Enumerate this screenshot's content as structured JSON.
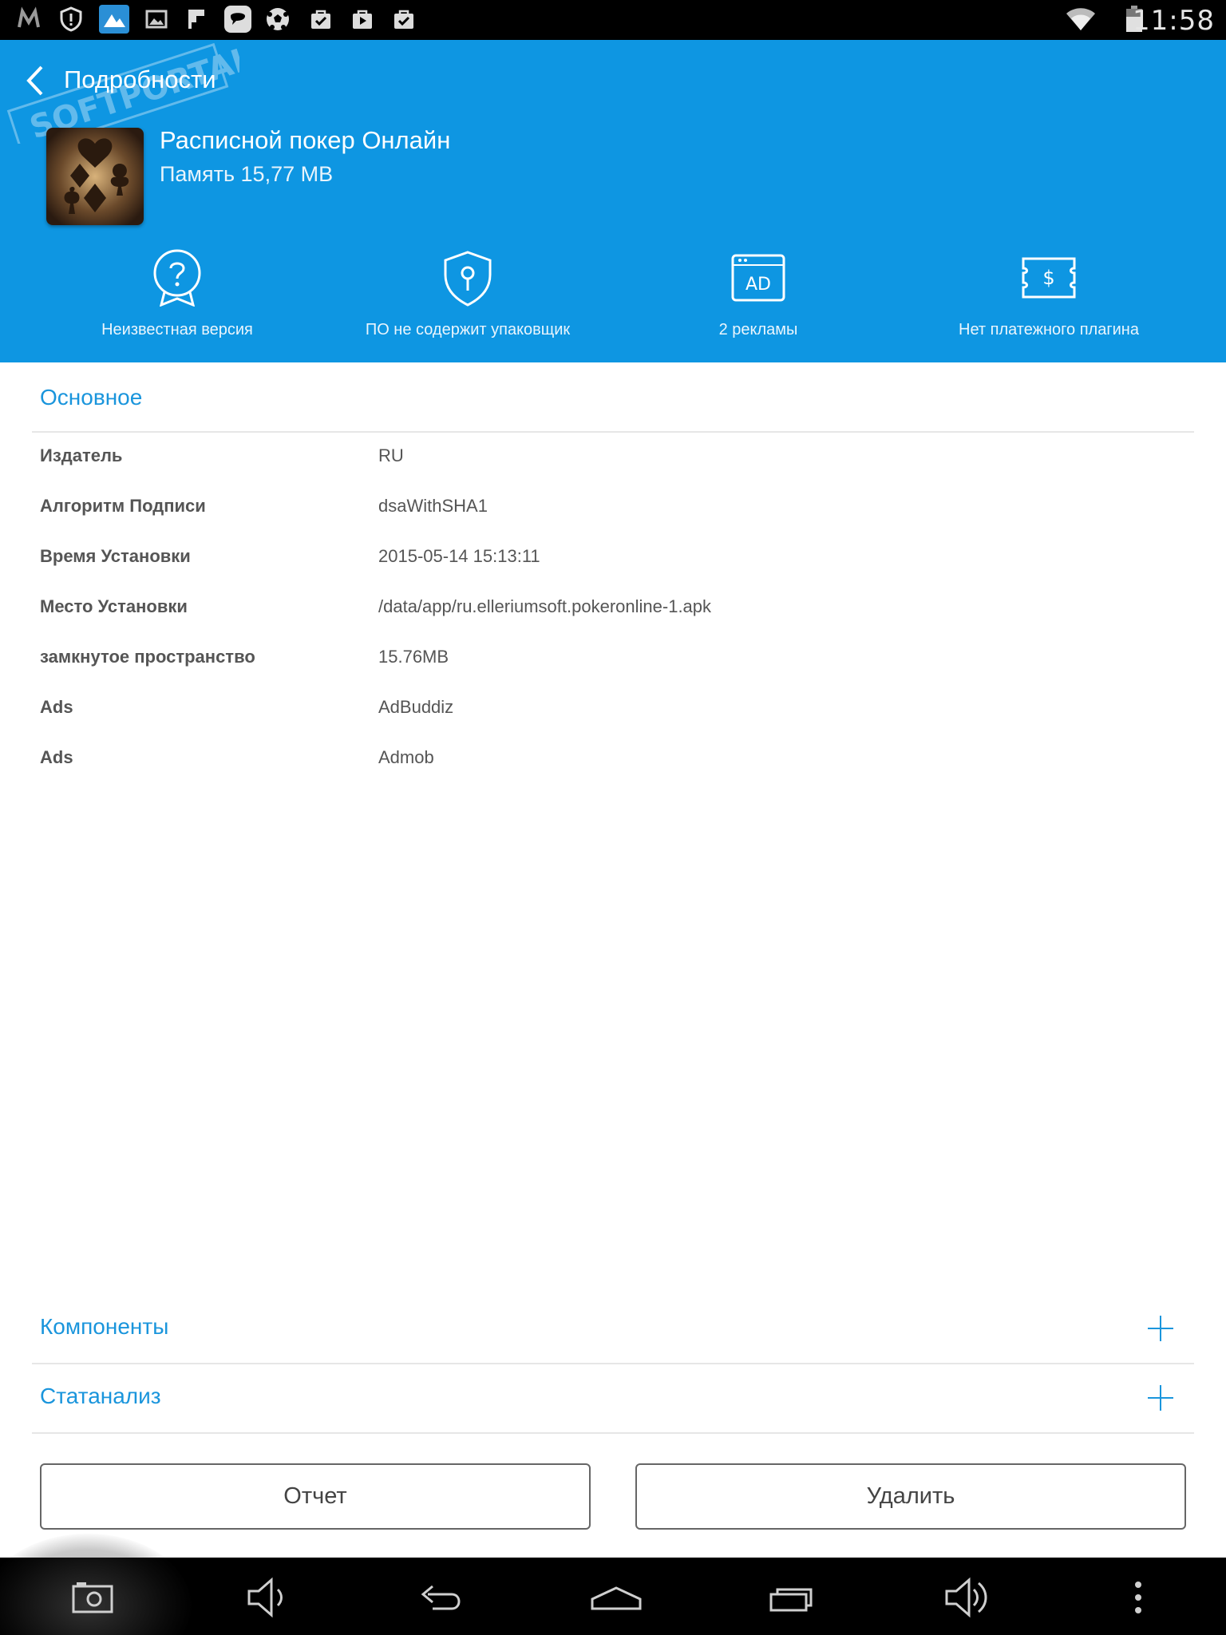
{
  "status_bar": {
    "time": "11:58",
    "icons": [
      "m-app-icon",
      "shield-alert-icon",
      "gallery-app-icon",
      "image-icon",
      "flipboard-icon",
      "chat-app-icon",
      "soccer-ball-icon",
      "bag-check-icon",
      "bag-play-icon",
      "bag-check-icon",
      "wifi-icon",
      "battery-icon"
    ]
  },
  "header": {
    "title": "Подробности",
    "app_name": "Расписной покер Онлайн",
    "memory": "Память 15,77 MB",
    "features": [
      {
        "icon": "question-badge-icon",
        "label": "Неизвестная версия"
      },
      {
        "icon": "shield-key-icon",
        "label": "ПО не содержит упаковщик"
      },
      {
        "icon": "ad-window-icon",
        "label": "2 рекламы"
      },
      {
        "icon": "dollar-card-icon",
        "label": "Нет платежного плагина"
      }
    ]
  },
  "main": {
    "section_title": "Основное",
    "rows": [
      {
        "key": "Издатель",
        "value": "RU"
      },
      {
        "key": "Алгоритм Подписи",
        "value": "dsaWithSHA1"
      },
      {
        "key": "Время Установки",
        "value": "2015-05-14 15:13:11"
      },
      {
        "key": "Место Установки",
        "value": "/data/app/ru.elleriumsoft.pokeronline-1.apk"
      },
      {
        "key": "замкнутое пространство",
        "value": "15.76MB"
      },
      {
        "key": "Ads",
        "value": "AdBuddiz"
      },
      {
        "key": "Ads",
        "value": "Admob"
      }
    ],
    "expandables": [
      {
        "label": "Компоненты"
      },
      {
        "label": "Статанализ"
      }
    ],
    "buttons": {
      "report": "Отчет",
      "delete": "Удалить"
    }
  },
  "nav_bar": {
    "buttons": [
      "screenshot-icon",
      "volume-down-icon",
      "back-icon",
      "home-icon",
      "recent-apps-icon",
      "volume-up-icon",
      "overflow-menu-icon"
    ]
  },
  "colors": {
    "header_blue": "#0e96e2",
    "accent_text": "#1a95dc"
  }
}
